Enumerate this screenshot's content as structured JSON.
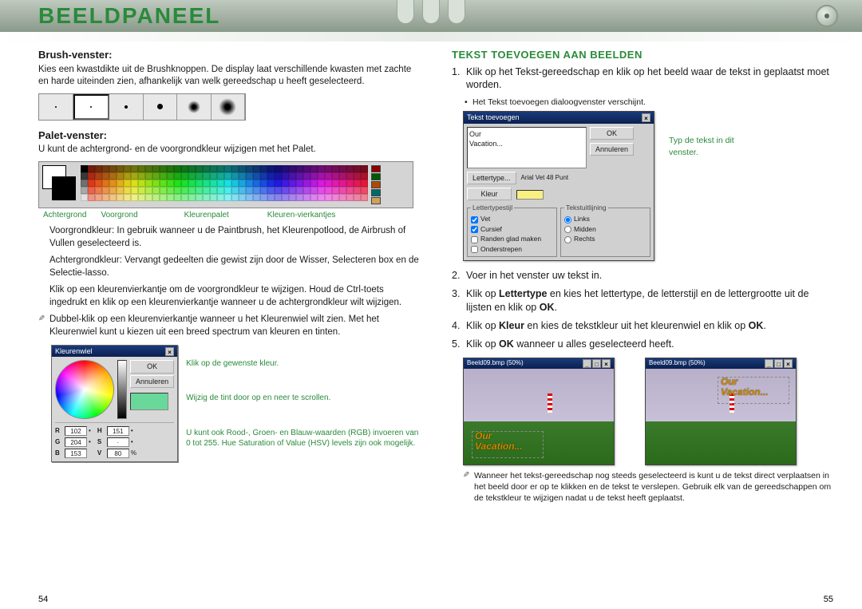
{
  "header": {
    "title": "BEELDPANEEL"
  },
  "left": {
    "brush_heading": "Brush-venster:",
    "brush_desc": "Kies een kwastdikte uit de Brushknoppen. De display laat verschillende kwasten met zachte en harde uiteinden zien, afhankelijk van welk gereedschap u heeft geselecteerd.",
    "palette_heading": "Palet-venster:",
    "palette_desc": "U kunt de achtergrond- en de voorgrondkleur wijzigen met het Palet.",
    "pal_labels": {
      "bg": "Achtergrond",
      "fg": "Voorgrond",
      "pal": "Kleurenpalet",
      "sq": "Kleuren-vierkantjes"
    },
    "fg_text": "Voorgrondkleur: In gebruik wanneer u de Paintbrush, het Kleurenpotlood, de Airbrush of Vullen geselecteerd is.",
    "bg_text": "Achtergrondkleur: Vervangt gedeelten die gewist zijn door de Wisser, Selecteren box en de Selectie-lasso.",
    "click_text": "Klik op een kleurenvierkantje om de voorgrondkleur te wijzigen. Houd de Ctrl-toets ingedrukt en klik op een kleurenvierkantje wanneer u de achtergrondkleur wilt wijzigen.",
    "wheel_tip": "Dubbel-klik op een kleurenvierkantje wanneer u het Kleurenwiel wilt zien. Met het Kleurenwiel kunt u kiezen uit een breed spectrum van kleuren en tinten.",
    "wheel_dialog": {
      "title": "Kleurenwiel",
      "ok": "OK",
      "cancel": "Annuleren",
      "r_label": "R",
      "r_val": "102",
      "h_label": "H",
      "h_val": "151",
      "g_label": "G",
      "g_val": "204",
      "s_label": "S",
      "s_val": "·",
      "b_label": "B",
      "b_val": "153",
      "v_label": "V",
      "v_val": "80"
    },
    "wheel_caps": {
      "c1": "Klik op de gewenste kleur.",
      "c2": "Wijzig de tint door op en neer te scrollen.",
      "c3": "U kunt ook Rood-, Groen- en Blauw-waarden (RGB) invoeren van 0 tot 255. Hue Saturation of Value (HSV) levels zijn ook mogelijk."
    }
  },
  "right": {
    "heading": "TEKST TOEVOEGEN AAN BEELDEN",
    "step1": "Klik op het Tekst-gereedschap en klik op het beeld waar de tekst in geplaatst moet worden.",
    "step1_note": "Het Tekst toevoegen  dialoogvenster verschijnt.",
    "dialog": {
      "title": "Tekst toevoegen",
      "text_value": "Our\nVacation...",
      "ok": "OK",
      "cancel": "Annuleren",
      "font_btn": "Lettertype...",
      "font_desc": "Arial Vet 48 Punt",
      "color_btn": "Kleur",
      "fs_style": "Lettertypestijl",
      "chk_bold": "Vet",
      "chk_italic": "Cursief",
      "chk_smooth": "Randen glad maken",
      "chk_under": "Onderstrepen",
      "fs_align": "Tekstuitlijning",
      "rad_left": "Links",
      "rad_center": "Midden",
      "rad_right": "Rechts",
      "side_caption": "Typ de tekst in dit venster."
    },
    "step2": "Voer in het venster uw tekst in.",
    "step3_a": "Klik op ",
    "step3_b1": "Lettertype",
    "step3_c": " en kies het lettertype, de letterstijl en de lettergrootte uit de lijsten en klik op ",
    "step3_b2": "OK",
    "step3_d": ".",
    "step4_a": "Klik op ",
    "step4_b1": "Kleur",
    "step4_c": " en kies de tekstkleur uit het kleurenwiel en klik op ",
    "step4_b2": "OK",
    "step4_d": ".",
    "step5_a": "Klik op ",
    "step5_b": "OK",
    "step5_c": " wanneer u alles geselecteerd heeft.",
    "thumb1_title": "Beeld09.bmp (50%)",
    "thumb2_title": "Beeld09.bmp (50%)",
    "overlay_l1": "Our",
    "overlay_l2": "Vacation...",
    "footnote": "Wanneer het tekst-gereedschap nog steeds geselecteerd is kunt u de tekst direct verplaatsen in het beeld door er op te klikken en de tekst te verslepen. Gebruik elk van de gereedschappen om de tekstkleur te wijzigen nadat u de tekst heeft geplaatst."
  },
  "page_left": "54",
  "page_right": "55"
}
